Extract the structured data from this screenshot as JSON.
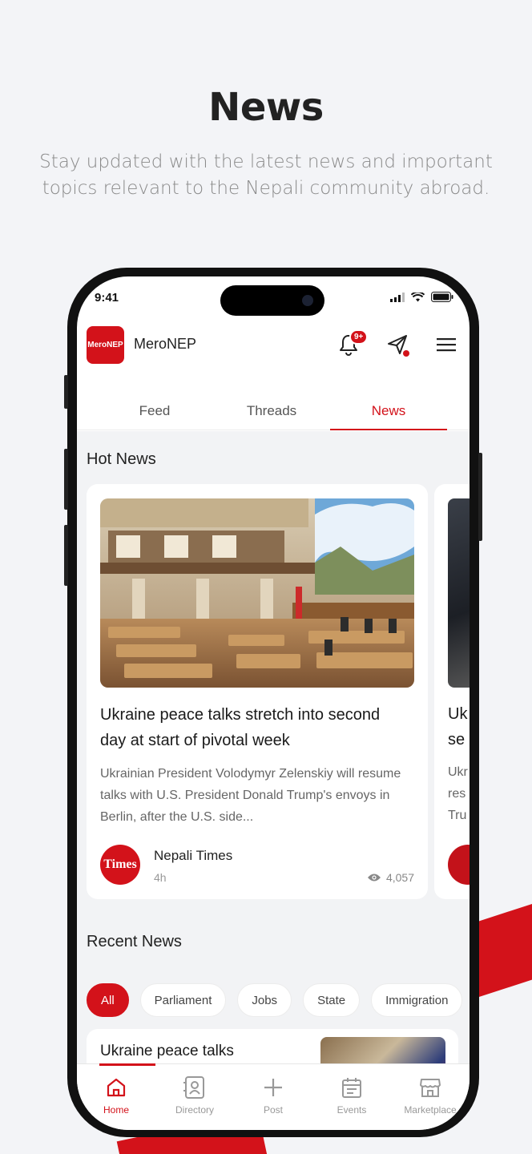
{
  "promo": {
    "title": "News",
    "subtitle": "Stay updated with the latest news and important topics relevant to the Nepali community abroad."
  },
  "status_bar": {
    "time": "9:41"
  },
  "header": {
    "logo_text": "MeroNEP",
    "app_name": "MeroNEP",
    "notification_badge": "9+"
  },
  "tabs": [
    {
      "label": "Feed",
      "active": false
    },
    {
      "label": "Threads",
      "active": false
    },
    {
      "label": "News",
      "active": true
    }
  ],
  "hot_news": {
    "section_title": "Hot News",
    "card": {
      "title": "Ukraine peace talks stretch into second day at start of pivotal week",
      "description": "Ukrainian President Volodymyr Zelenskiy will resume talks with U.S. President Donald Trump's envoys in Berlin, after the U.S. side...",
      "source_logo_text": "Times",
      "source_name": "Nepali Times",
      "time_ago": "4h",
      "views": "4,057"
    },
    "peek_card": {
      "title_line1": "Uk",
      "title_line2": "se",
      "desc_line1": "Ukr",
      "desc_line2": "res",
      "desc_line3": "Tru"
    }
  },
  "recent_news": {
    "section_title": "Recent News",
    "filters": [
      {
        "label": "All",
        "active": true
      },
      {
        "label": "Parliament",
        "active": false
      },
      {
        "label": "Jobs",
        "active": false
      },
      {
        "label": "State",
        "active": false
      },
      {
        "label": "Immigration",
        "active": false
      }
    ],
    "first_item_title": "Ukraine peace talks"
  },
  "bottom_nav": [
    {
      "label": "Home",
      "icon": "home-icon",
      "active": true
    },
    {
      "label": "Directory",
      "icon": "directory-icon",
      "active": false
    },
    {
      "label": "Post",
      "icon": "plus-icon",
      "active": false
    },
    {
      "label": "Events",
      "icon": "calendar-icon",
      "active": false
    },
    {
      "label": "Marketplace",
      "icon": "store-icon",
      "active": false
    }
  ],
  "colors": {
    "accent": "#d3121a",
    "background": "#f3f4f7",
    "text_muted": "#8a8a8a"
  }
}
